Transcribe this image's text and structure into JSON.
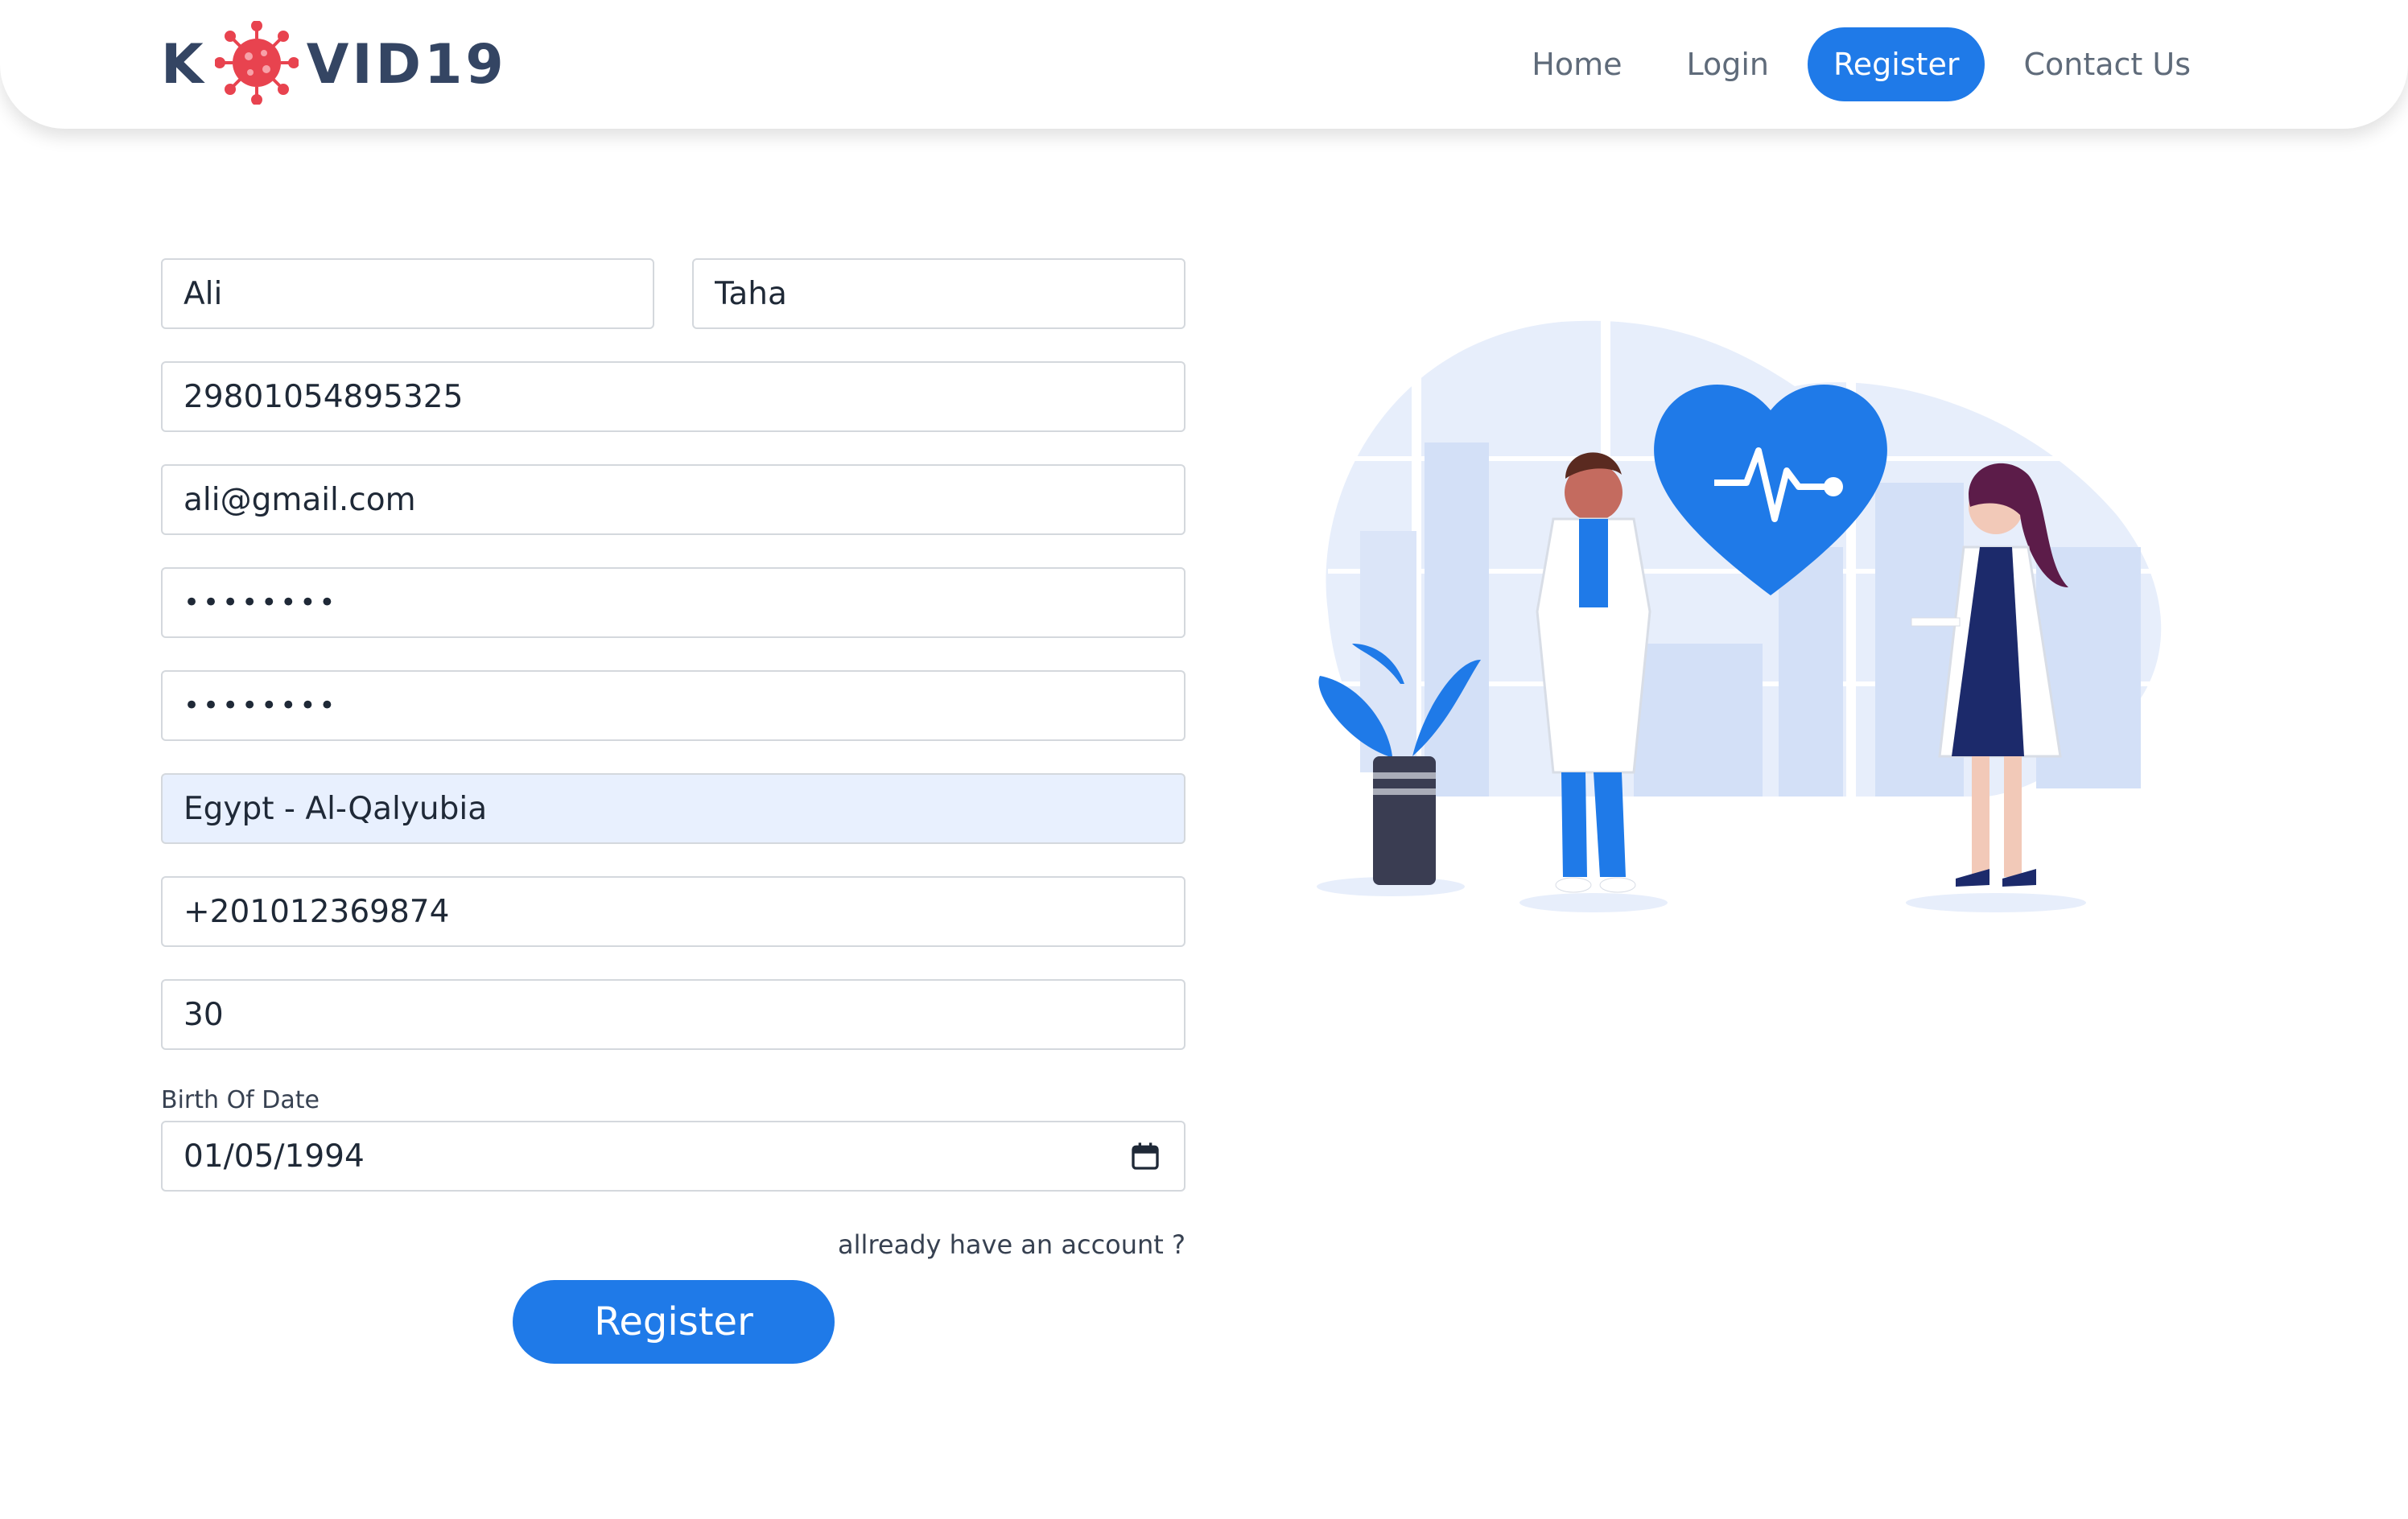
{
  "brand": {
    "logo_left": "K",
    "logo_right": "VID19",
    "logo_text_color": "#344563",
    "virus_color": "#e8434f"
  },
  "nav": {
    "items": [
      "Home",
      "Login",
      "Register",
      "Contact Us"
    ],
    "active": "Register",
    "accent": "#1f7ae8"
  },
  "form": {
    "first_name": "Ali",
    "last_name": "Taha",
    "national_id": "29801054895325",
    "email": "ali@gmail.com",
    "password": "password",
    "confirm_password": "password",
    "location": "Egypt - Al-Qalyubia",
    "phone": "+201012369874",
    "age": "30",
    "birth_label": "Birth Of Date",
    "birth_date": "01/05/1994",
    "already_link": "allready have an account ?",
    "submit_label": "Register"
  },
  "icons": {
    "calendar": "calendar-icon",
    "logo_virus": "virus-icon"
  },
  "illustration": {
    "subject": "doctors-with-heart-illustration",
    "heart_color": "#1f7ae8"
  }
}
